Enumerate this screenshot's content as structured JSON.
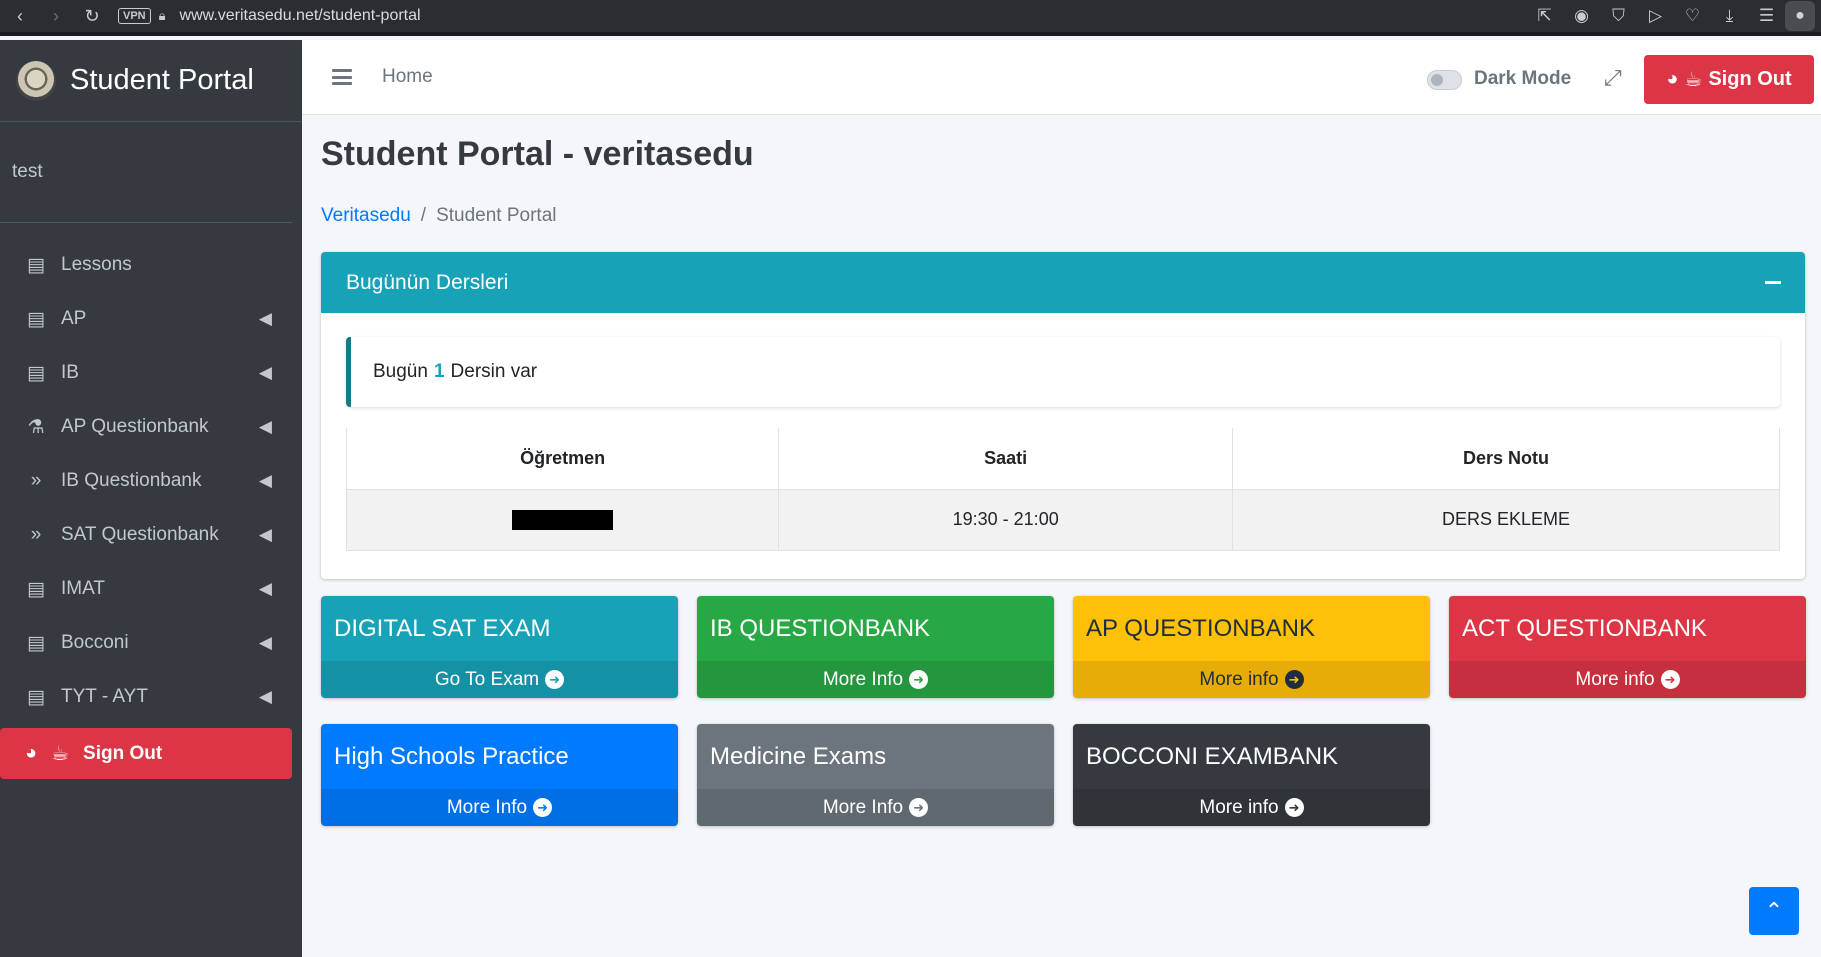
{
  "browser": {
    "url": "www.veritasedu.net/student-portal",
    "vpn_label": "VPN"
  },
  "sidebar": {
    "brand": "Student Portal",
    "user": "test",
    "items": [
      {
        "label": "Lessons",
        "icon": "file-text-icon",
        "has_chevron": false
      },
      {
        "label": "AP",
        "icon": "book-icon",
        "has_chevron": true
      },
      {
        "label": "IB",
        "icon": "book-icon",
        "has_chevron": true
      },
      {
        "label": "AP Questionbank",
        "icon": "flask-icon",
        "has_chevron": true
      },
      {
        "label": "IB Questionbank",
        "icon": "double-chevron-icon",
        "has_chevron": true
      },
      {
        "label": "SAT Questionbank",
        "icon": "double-chevron-icon",
        "has_chevron": true
      },
      {
        "label": "IMAT",
        "icon": "book-icon",
        "has_chevron": true
      },
      {
        "label": "Bocconi",
        "icon": "book-icon",
        "has_chevron": true
      },
      {
        "label": "TYT - AYT",
        "icon": "book-icon",
        "has_chevron": true
      }
    ],
    "signout_label": "Sign Out"
  },
  "topbar": {
    "home_label": "Home",
    "dark_mode_label": "Dark Mode",
    "signout_label": "Sign Out"
  },
  "page": {
    "title": "Student Portal - veritasedu",
    "breadcrumb": {
      "link": "Veritasedu",
      "separator": "/",
      "current": "Student Portal"
    }
  },
  "today_card": {
    "title": "Bugünün Dersleri",
    "callout_pre": "Bugün",
    "callout_count": "1",
    "callout_post": "Dersin var",
    "columns": [
      "Öğretmen",
      "Saati",
      "Ders Notu"
    ],
    "rows": [
      {
        "teacher": "",
        "time": "19:30 - 21:00",
        "note": "DERS EKLEME"
      }
    ]
  },
  "boxes": [
    {
      "title": "DIGITAL SAT EXAM",
      "link": "Go To Exam",
      "color": "#17a2b8",
      "footer_color": "#1591a5"
    },
    {
      "title": "IB QUESTIONBANK",
      "link": "More Info",
      "color": "#28a745",
      "footer_color": "#24963e"
    },
    {
      "title": "AP QUESTIONBANK",
      "link": "More info",
      "color": "#ffc107",
      "footer_color": "#e5ad06"
    },
    {
      "title": "ACT QUESTIONBANK",
      "link": "More info",
      "color": "#dc3545",
      "footer_color": "#c62f3e"
    },
    {
      "title": "High Schools Practice",
      "link": "More Info",
      "color": "#007bff",
      "footer_color": "#006fe6"
    },
    {
      "title": "Medicine Exams",
      "link": "More Info",
      "color": "#6c757d",
      "footer_color": "#616970"
    },
    {
      "title": "BOCCONI EXAMBANK",
      "link": "More info",
      "color": "#343a40",
      "footer_color": "#2f3439"
    }
  ]
}
